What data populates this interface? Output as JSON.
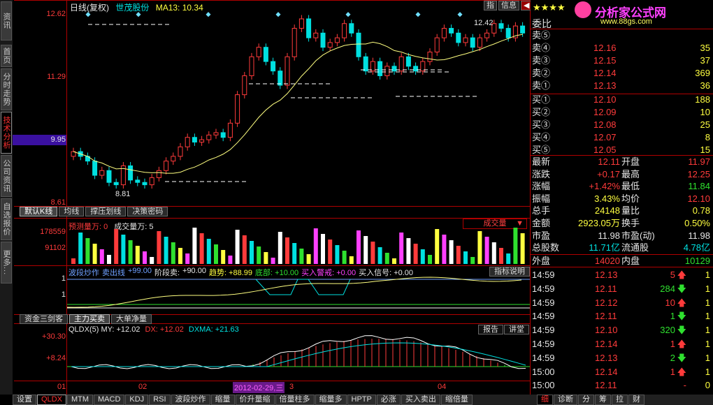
{
  "left_tabs": [
    "资讯",
    "首页",
    "分时走势",
    "技术分析",
    "公司资讯",
    "自选报价",
    "更多..."
  ],
  "left_tabs_active": "技术分析",
  "main_chart": {
    "header_period": "日线(复权)",
    "stock_name": "世茂股份",
    "ma_label": "MA13: 10.34",
    "y_labels": [
      "12.62",
      "11.29",
      "9.95",
      "8.61"
    ],
    "current_price_label": "9.95",
    "high_marker": "12.42",
    "low_marker": "8.81",
    "btn_indicator": "指",
    "btn_info": "信息",
    "btn_prev": "◀",
    "btn_next": "▶"
  },
  "indicator_tabs_1": [
    "默认K线",
    "均线",
    "撑压划线",
    "决策密码"
  ],
  "volume_panel": {
    "forecast_label": "预测量万: 0",
    "volume_label": "成交量万: 5",
    "y_labels": [
      "178559",
      "91102"
    ],
    "selector": "成交量"
  },
  "band_panel": {
    "items": [
      {
        "text": "波段炒作",
        "color": "#6fa0ff"
      },
      {
        "text": "卖出线",
        "color": "#6fa0ff"
      },
      {
        "text": "+99.00",
        "color": "#6fa0ff"
      },
      {
        "text": "阶段卖:",
        "color": "#e6e6e6"
      },
      {
        "text": "+90.00",
        "color": "#e6e6e6"
      },
      {
        "text": "趋势: +88.99",
        "color": "#ffff40"
      },
      {
        "text": "底部: +10.00",
        "color": "#2fe02f"
      },
      {
        "text": "买入警戒: +0.00",
        "color": "#ff40ff"
      },
      {
        "text": "买入信号: +0.00",
        "color": "#e6e6e6"
      }
    ],
    "y_labels": [
      "1",
      "1"
    ],
    "help_button": "指标说明"
  },
  "indicator_tabs_2": [
    "资金三剑客",
    "主力买卖",
    "大单净量"
  ],
  "qldx_panel": {
    "title": "QLDX(5)",
    "my": "MY: +12.02",
    "dx": "DX: +12.02",
    "dxma": "DXMA: +21.63",
    "y_labels": [
      "+30.30",
      "+8.24"
    ],
    "btn_report": "报告",
    "btn_talk": "讲堂"
  },
  "x_axis": [
    "01",
    "02",
    "2012-02-29,三",
    "3",
    "04"
  ],
  "bottom_tabs": [
    "设置",
    "QLDX",
    "MTM",
    "MACD",
    "KDJ",
    "RSI",
    "波段炒作",
    "缩量",
    "价升量缩",
    "倍量柱多",
    "缩量多",
    "HPTP",
    "必涨",
    "买入卖出",
    "缩倍量"
  ],
  "bottom_active": "QLDX",
  "right_tabs": [
    "细",
    "诊断",
    "分",
    "筹",
    "拉",
    "财"
  ],
  "right_tab_active": "细",
  "watermark": {
    "stars": "★★★★",
    "brand": "分析家公式网",
    "url": "www.88gs.com"
  },
  "weibi_label": "委比",
  "asks": [
    {
      "label": "卖⑤",
      "price": "",
      "vol": ""
    },
    {
      "label": "卖④",
      "price": "12.16",
      "vol": "35"
    },
    {
      "label": "卖③",
      "price": "12.15",
      "vol": "37"
    },
    {
      "label": "卖②",
      "price": "12.14",
      "vol": "369"
    },
    {
      "label": "卖①",
      "price": "12.13",
      "vol": "36"
    }
  ],
  "bids": [
    {
      "label": "买①",
      "price": "12.10",
      "vol": "188"
    },
    {
      "label": "买②",
      "price": "12.09",
      "vol": "10"
    },
    {
      "label": "买③",
      "price": "12.08",
      "vol": "25"
    },
    {
      "label": "买④",
      "price": "12.07",
      "vol": "8"
    },
    {
      "label": "买⑤",
      "price": "12.05",
      "vol": "15"
    }
  ],
  "stats": [
    {
      "l": "最新",
      "v": "12.11",
      "vc": "red",
      "l2": "开盘",
      "v2": "11.97",
      "v2c": "red"
    },
    {
      "l": "涨跌",
      "v": "+0.17",
      "vc": "red",
      "l2": "最高",
      "v2": "12.25",
      "v2c": "red"
    },
    {
      "l": "涨幅",
      "v": "+1.42%",
      "vc": "red",
      "l2": "最低",
      "v2": "11.84",
      "v2c": "green"
    },
    {
      "l": "振幅",
      "v": "3.43%",
      "vc": "yellow",
      "l2": "均价",
      "v2": "12.10",
      "v2c": "red"
    },
    {
      "l": "总手",
      "v": "24148",
      "vc": "yellow",
      "l2": "量比",
      "v2": "0.78",
      "v2c": "yellow"
    },
    {
      "l": "金额",
      "v": "2923.05万",
      "vc": "yellow",
      "l2": "换手",
      "v2": "0.50%",
      "v2c": "yellow"
    },
    {
      "l": "市盈",
      "v": "11.98",
      "vc": "white",
      "l2": "市盈(动)",
      "v2": "11.98",
      "v2c": "white"
    },
    {
      "l": "总股数",
      "v": "11.71亿",
      "vc": "cyan",
      "l2": "流通股",
      "v2": "4.78亿",
      "v2c": "cyan"
    }
  ],
  "outer_inner": {
    "outer_label": "外盘",
    "outer": "14020",
    "inner_label": "内盘",
    "inner": "10129"
  },
  "ticks": [
    {
      "t": "14:59",
      "p": "12.13",
      "pc": "red",
      "v": "5",
      "arrow": "up",
      "n": "1"
    },
    {
      "t": "14:59",
      "p": "12.11",
      "pc": "red",
      "v": "284",
      "arrow": "down",
      "n": "1"
    },
    {
      "t": "14:59",
      "p": "12.12",
      "pc": "red",
      "v": "10",
      "arrow": "up",
      "n": "1"
    },
    {
      "t": "14:59",
      "p": "12.11",
      "pc": "red",
      "v": "1",
      "arrow": "down",
      "n": "1"
    },
    {
      "t": "14:59",
      "p": "12.10",
      "pc": "red",
      "v": "320",
      "arrow": "down",
      "n": "1"
    },
    {
      "t": "14:59",
      "p": "12.14",
      "pc": "red",
      "v": "1",
      "arrow": "up",
      "n": "1"
    },
    {
      "t": "14:59",
      "p": "12.13",
      "pc": "red",
      "v": "2",
      "arrow": "down",
      "n": "1"
    },
    {
      "t": "15:00",
      "p": "12.14",
      "pc": "red",
      "v": "1",
      "arrow": "up",
      "n": "1"
    },
    {
      "t": "15:00",
      "p": "12.11",
      "pc": "red",
      "v": "",
      "arrow": "dash",
      "n": "0"
    }
  ],
  "colors": {
    "up": "#ff3b3b",
    "down": "#00e0e0",
    "ma": "#ffff80",
    "frame": "#b00000"
  }
}
